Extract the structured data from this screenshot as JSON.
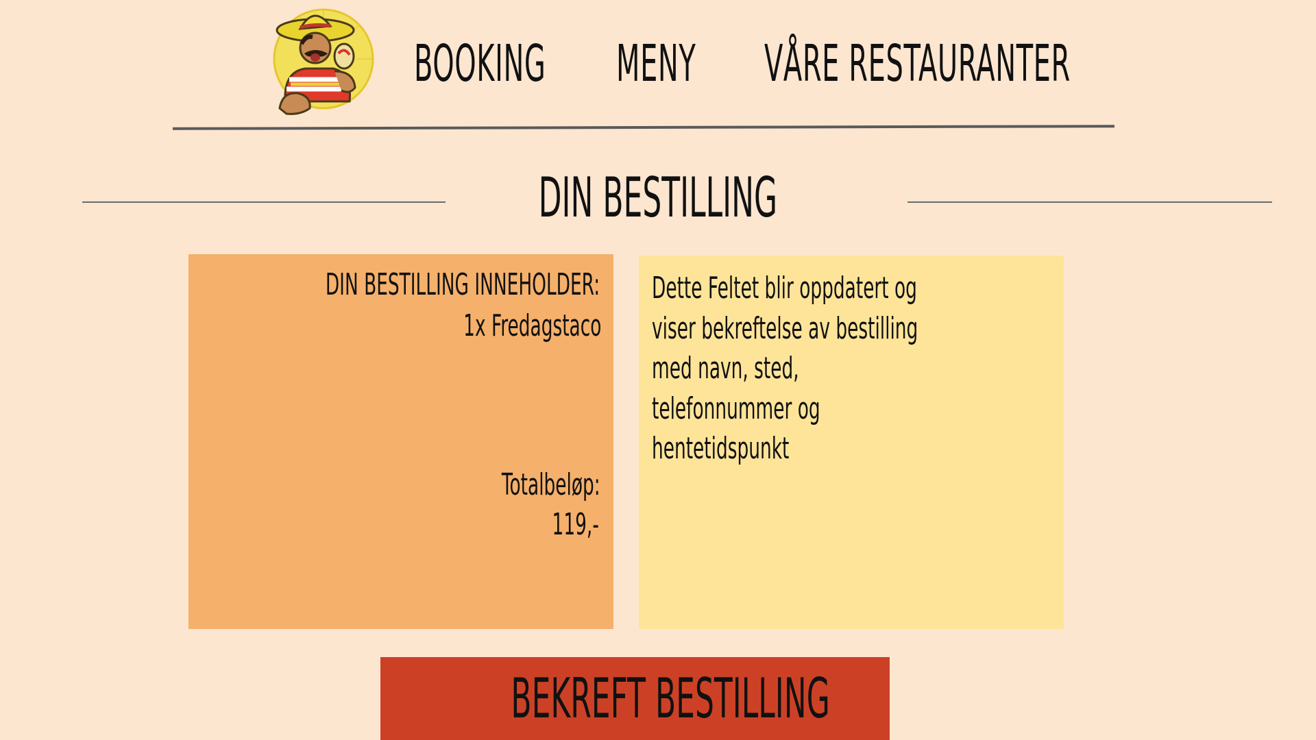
{
  "nav": {
    "logo_icon": "mexican-mascot-logo",
    "links": [
      {
        "label": "BOOKING"
      },
      {
        "label": "MENY"
      },
      {
        "label": "VÅRE RESTAURANTER"
      }
    ]
  },
  "page": {
    "title": "DIN BESTILLING"
  },
  "order": {
    "heading": "DIN BESTILLING INNEHOLDER:",
    "item": "1x Fredagstaco",
    "total_label": "Totalbeløp:",
    "total_value": "119,-"
  },
  "confirmation": {
    "lines": [
      "Dette Feltet blir oppdatert og",
      "viser bekreftelse av bestilling",
      "med navn, sted,",
      "telefonnummer og",
      "hentetidspunkt"
    ]
  },
  "actions": {
    "confirm_label": "BEKREFT BESTILLING"
  },
  "colors": {
    "background": "#fde6d0",
    "order_box": "#f5b06b",
    "confirm_box": "#fee499",
    "button": "#cc4126"
  }
}
